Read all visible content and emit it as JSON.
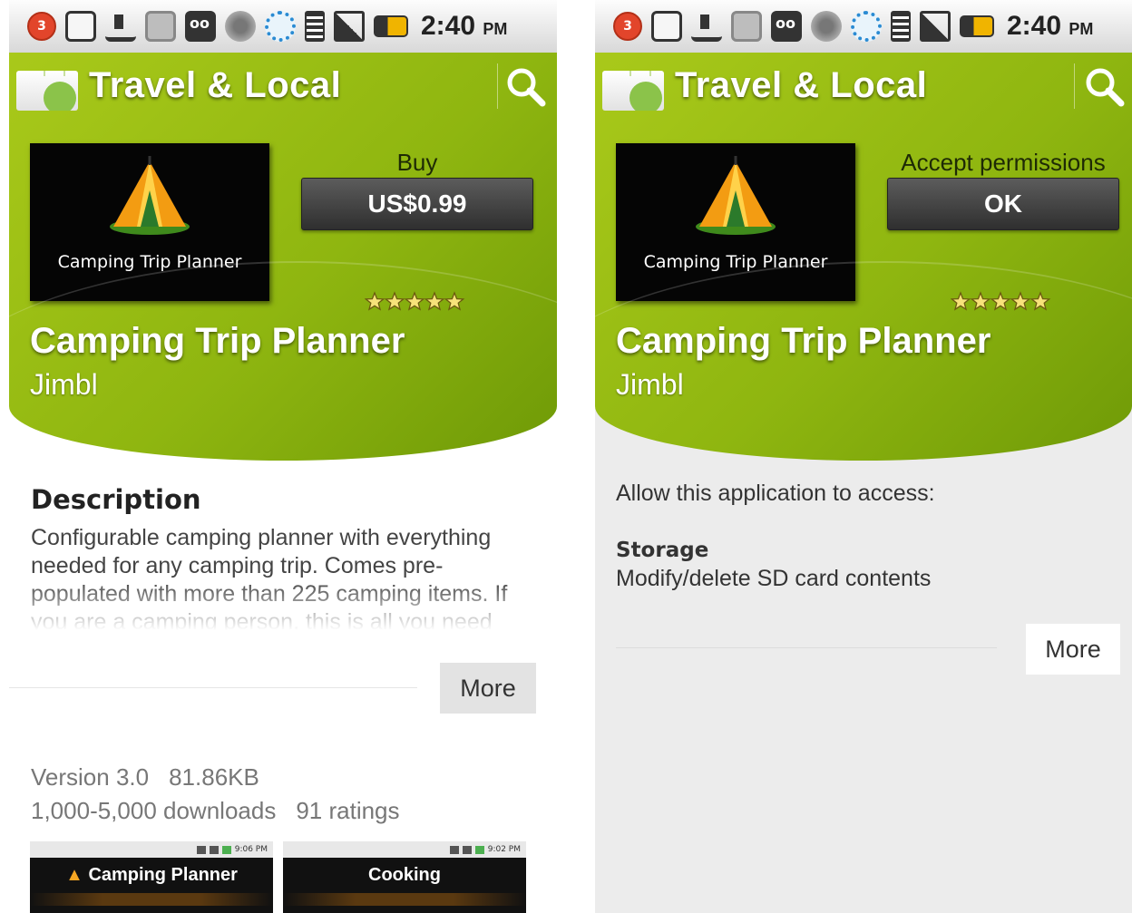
{
  "status_bar": {
    "notification_count": "3",
    "time": "2:40",
    "ampm": "PM",
    "icons": [
      "notification-badge-icon",
      "shopping-bag-icon",
      "download-icon",
      "photo-icon",
      "voicemail-icon",
      "record-icon",
      "sync-icon",
      "wifi-icon",
      "signal-icon",
      "battery-icon"
    ]
  },
  "colors": {
    "header_green": "#8fb610",
    "action_button": "#3c3c3c",
    "badge_red": "#e2452b"
  },
  "left": {
    "header": {
      "category": "Travel & Local"
    },
    "app": {
      "tile_label": "Camping Trip Planner",
      "name": "Camping Trip Planner",
      "developer": "Jimbl",
      "rating_stars": 5
    },
    "action": {
      "label": "Buy",
      "button": "US$0.99"
    },
    "description": {
      "heading": "Description",
      "body": "Configurable camping planner with everything needed for any camping trip. Comes pre-populated with more than 225 camping items. If you are a camping person, this is all you need"
    },
    "more_button": "More",
    "meta": {
      "version": "Version 3.0",
      "size": "81.86KB",
      "downloads": "1,000-5,000 downloads",
      "ratings": "91 ratings"
    },
    "screenshots": [
      {
        "time": "9:06 PM",
        "title": "Camping Planner"
      },
      {
        "time": "9:02 PM",
        "title": "Cooking"
      }
    ]
  },
  "right": {
    "header": {
      "category": "Travel & Local"
    },
    "app": {
      "tile_label": "Camping Trip Planner",
      "name": "Camping Trip Planner",
      "developer": "Jimbl",
      "rating_stars": 5
    },
    "action": {
      "label": "Accept permissions",
      "button": "OK"
    },
    "permissions": {
      "intro": "Allow this application to access:",
      "items": [
        {
          "title": "Storage",
          "desc": "Modify/delete SD card contents"
        }
      ]
    },
    "more_button": "More"
  }
}
